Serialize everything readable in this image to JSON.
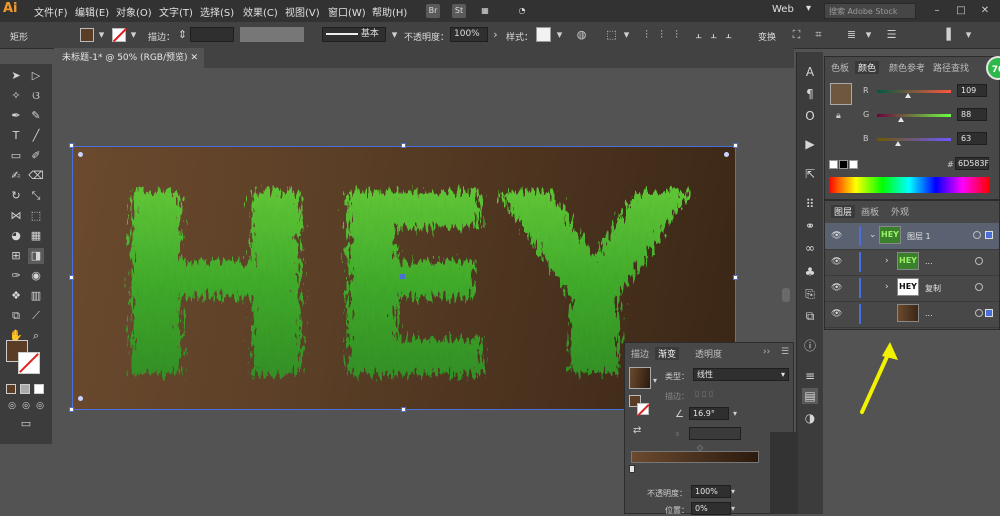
{
  "menubar": {
    "logo": "Ai",
    "items": [
      "文件(F)",
      "编辑(E)",
      "对象(O)",
      "文字(T)",
      "选择(S)",
      "效果(C)",
      "视图(V)",
      "窗口(W)",
      "帮助(H)"
    ],
    "mini_icons": [
      "Br",
      "St"
    ],
    "workspace": "Web",
    "search_placeholder": "搜索 Adobe Stock"
  },
  "controlbar": {
    "object_type": "矩形",
    "stroke_label": "描边：",
    "stroke_profile": "基本",
    "opacity_label": "不透明度：",
    "opacity_value": "100%",
    "style_label": "样式：",
    "transform_label": "变换"
  },
  "document": {
    "tab_title": "未标题-1* @ 50% (RGB/预览)",
    "artwork_text": "HEY"
  },
  "color_panel": {
    "tabs": [
      "色板",
      "颜色",
      "颜色参考",
      "路径查找"
    ],
    "active_tab": "颜色",
    "r": {
      "label": "R",
      "value": "109"
    },
    "g": {
      "label": "G",
      "value": "88"
    },
    "b": {
      "label": "B",
      "value": "63"
    },
    "hex_label": "#",
    "hex": "6D583F",
    "swatch_color": "#6D583F"
  },
  "layers_panel": {
    "tabs": [
      "图层",
      "画板",
      "外观"
    ],
    "active_tab": "图层",
    "rows": [
      {
        "name": "图层 1",
        "thumb": "HEY"
      },
      {
        "name": "...",
        "thumb": "HEY"
      },
      {
        "name": "复制",
        "thumb": "HEY"
      },
      {
        "name": "...",
        "thumb": ""
      }
    ],
    "badge": "70"
  },
  "gradient_panel": {
    "tabs": [
      "描边",
      "渐变",
      "透明度"
    ],
    "active_tab": "渐变",
    "type_label": "类型：",
    "type_value": "线性",
    "stroke_label": "描边：",
    "angle_value": "16.9°",
    "opacity_label": "不透明度：",
    "opacity_value": "100%",
    "position_label": "位置：",
    "position_value": "0%"
  }
}
